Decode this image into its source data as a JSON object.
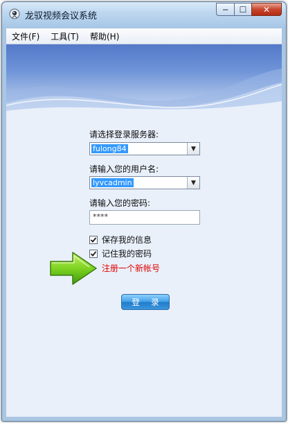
{
  "window": {
    "title": "龙驭视频会议系统",
    "minimize_symbol": "−",
    "maximize_symbol": "☐",
    "close_symbol": "✕"
  },
  "menu": {
    "items": [
      "文件(F)",
      "工具(T)",
      "帮助(H)"
    ]
  },
  "form": {
    "server_label": "请选择登录服务器:",
    "server_value": "fulong84",
    "username_label": "请输入您的用户名:",
    "username_value": "lyvcadmin",
    "password_label": "请输入您的密码:",
    "password_value": "****",
    "save_info_label": "保存我的信息",
    "save_info_checked": true,
    "remember_password_label": "记住我的密码",
    "remember_password_checked": true,
    "register_link": "注册一个新帐号",
    "login_button": "登 录"
  },
  "colors": {
    "accent_blue": "#3c95dd",
    "link_red": "#e00000",
    "arrow_green": "#7ed321"
  },
  "icons": {
    "app": "app-logo-icon",
    "combo_dropdown": "chevron-down-icon",
    "check": "check-icon",
    "pointer_arrow": "green-arrow-icon"
  }
}
